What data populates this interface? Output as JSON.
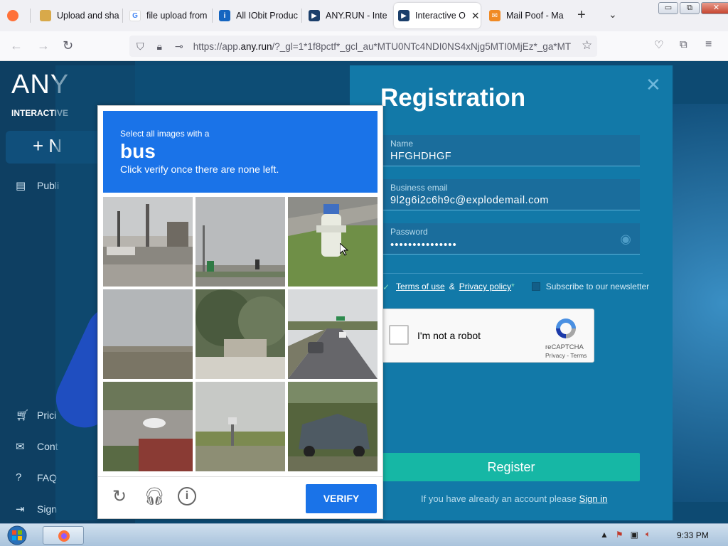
{
  "browser": {
    "tabs": [
      {
        "label": "",
        "icon": "firefox-icon"
      },
      {
        "label": "Upload and sha",
        "icon": "folder-icon"
      },
      {
        "label": "file upload from",
        "icon": "google-icon"
      },
      {
        "label": "All IObit Produc",
        "icon": "iobit-icon"
      },
      {
        "label": "ANY.RUN - Inte",
        "icon": "anyrun-icon"
      },
      {
        "label": "Interactive O",
        "icon": "anyrun-icon",
        "active": true
      },
      {
        "label": "Mail Poof - Ma",
        "icon": "mailpoof-icon"
      }
    ],
    "new_tab": "+",
    "tab_list": "⌄",
    "url_prefix": "https://app.",
    "url_domain": "any.run",
    "url_rest": "/?_gl=1*1f8pctf*_gcl_au*MTU0NTc4NDI0NS4xNjg5MTI0MjEz*_ga*MT",
    "window_buttons": [
      "▭",
      "⧉",
      "✕"
    ]
  },
  "sidebar": {
    "logo": "ANY",
    "logo_sub": "INTERACTIVE",
    "new_button": "+ N",
    "items_top": [
      {
        "label": "Publi",
        "icon": "file-icon"
      }
    ],
    "items_bottom": [
      {
        "label": "Prici",
        "icon": "cart-icon"
      },
      {
        "label": "Cont",
        "icon": "mail-icon"
      },
      {
        "label": "FAQ",
        "icon": "help-icon"
      },
      {
        "label": "Sign",
        "icon": "signout-icon"
      }
    ]
  },
  "registration": {
    "title": "Registration",
    "close": "✕",
    "name_label": "Name",
    "name_value": "HFGHDHGF",
    "email_label": "Business email",
    "email_value": "9l2g6i2c6h9c@explodemail.com",
    "password_label": "Password",
    "password_value": "•••••••••••••••",
    "terms_of_use": "Terms of use",
    "amp": "&",
    "privacy_policy": "Privacy policy",
    "required_star": "*",
    "newsletter": "Subscribe to our newsletter",
    "register": "Register",
    "signin_prompt": "If you have already an account please",
    "signin_link": "Sign in"
  },
  "recaptcha": {
    "label": "I'm not a robot",
    "brand": "reCAPTCHA",
    "links": "Privacy - Terms",
    "accent": "#4a90e2"
  },
  "challenge": {
    "line1": "Select all images with a",
    "target": "bus",
    "line2": "Click verify once there are none left.",
    "verify": "VERIFY",
    "accent": "#1a73e8",
    "tiles": [
      "street-with-poles",
      "highway-signs",
      "fire-hydrant",
      "cloudy-field",
      "tree-and-wall",
      "highway-cars",
      "car-on-road",
      "field-with-sign",
      "parked-car"
    ]
  },
  "taskbar": {
    "clock": "9:33 PM"
  }
}
